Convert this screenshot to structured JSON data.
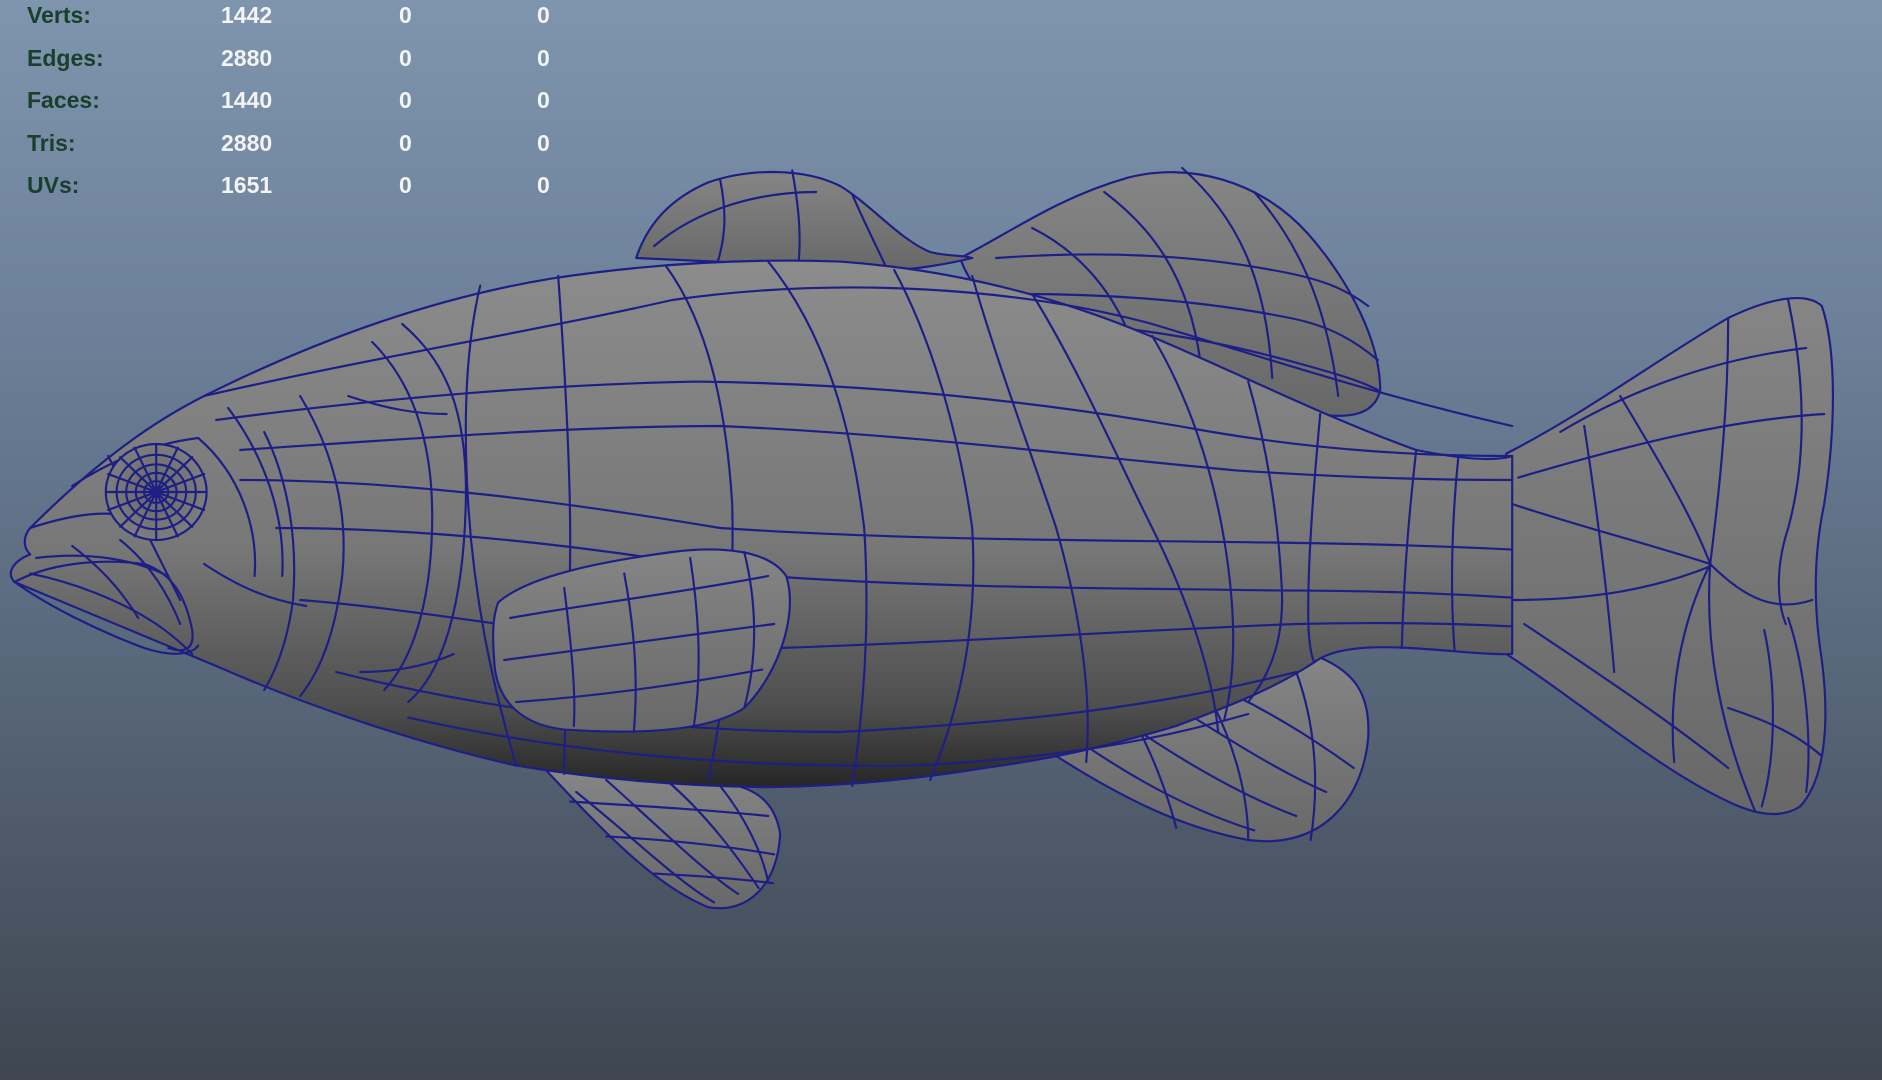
{
  "hud": {
    "rows": [
      {
        "label": "Verts:",
        "values": [
          "1442",
          "0",
          "0"
        ]
      },
      {
        "label": "Edges:",
        "values": [
          "2880",
          "0",
          "0"
        ]
      },
      {
        "label": "Faces:",
        "values": [
          "1440",
          "0",
          "0"
        ]
      },
      {
        "label": "Tris:",
        "values": [
          "2880",
          "0",
          "0"
        ]
      },
      {
        "label": "UVs:",
        "values": [
          "1651",
          "0",
          "0"
        ]
      }
    ]
  },
  "colors": {
    "hud_label": "#1a3f2c",
    "hud_value": "#f2f4f6",
    "wireframe": "#1d1f86",
    "mesh_fill": "#7a7a7a"
  },
  "icons": {
    "model": "fish-mesh-icon"
  }
}
